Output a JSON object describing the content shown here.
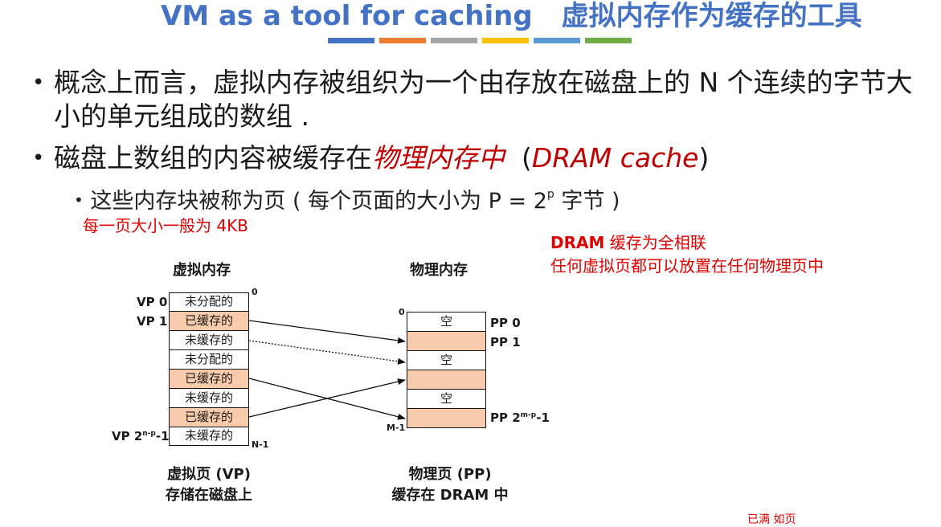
{
  "title": {
    "en": "VM as a tool for caching",
    "cn": "虚拟内存作为缓存的工具",
    "stripe_colors": [
      "#4472c4",
      "#ed7d31",
      "#a5a5a5",
      "#ffc000",
      "#5b9bd5",
      "#70ad47"
    ]
  },
  "bullets": {
    "b1": "概念上而言，虚拟内存被组织为一个由存放在磁盘上的 N 个连续的字节大小的单元组成的数组 .",
    "b2_pre": "磁盘上数组的内容被缓存在",
    "b2_em": "物理内存中",
    "b2_open": "  (",
    "b2_paren_em": "DRAM cache",
    "b2_close": ")",
    "sub_pre": "这些内存块被称为页  ( 每个页面的大小为 P = 2",
    "sub_sup": "p",
    "sub_post": " 字节 )"
  },
  "notes": {
    "page_size": "每一页大小一般为 4KB",
    "dram_bold": "DRAM",
    "dram_rest": " 缓存为全相联",
    "dram_line2": "任何虚拟页都可以放置在任何物理页中",
    "cut_text": "已满 如页"
  },
  "diagram": {
    "vm_heading": "虚拟内存",
    "pm_heading": "物理内存",
    "vm_cells": [
      "未分配的",
      "已缓存的",
      "未缓存的",
      "未分配的",
      "已缓存的",
      "未缓存的",
      "已缓存的",
      "未缓存的"
    ],
    "vm_labels": {
      "vp0": "VP 0",
      "vp1": "VP 1",
      "vplast_pre": "VP 2",
      "vplast_sup": "n-p",
      "vplast_post": "-1"
    },
    "vm_index_top": "0",
    "vm_index_bottom": "N-1",
    "pm_cells": [
      "空",
      "",
      "空",
      "",
      "空",
      ""
    ],
    "pm_labels": {
      "pp0": "PP 0",
      "pp1": "PP 1",
      "pplast_pre": "PP 2",
      "pplast_sup": "m-p",
      "pplast_post": "-1"
    },
    "pm_index_top": "0",
    "pm_index_bottom": "M-1",
    "vm_caption_1": "虚拟页 (VP)",
    "vm_caption_2": "存储在磁盘上",
    "pm_caption_1": "物理页  (PP)",
    "pm_caption_2": "缓存在 DRAM 中"
  }
}
